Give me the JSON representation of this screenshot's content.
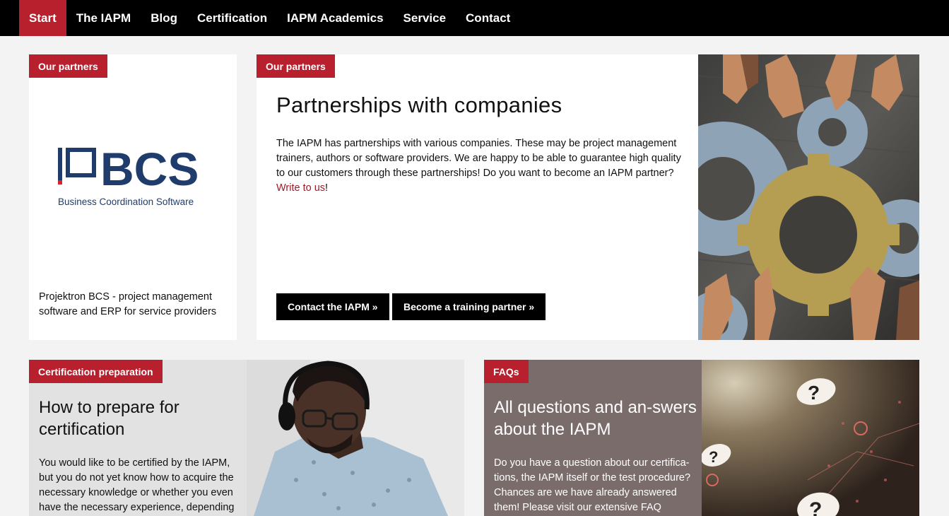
{
  "nav": {
    "items": [
      {
        "label": "Start",
        "active": true
      },
      {
        "label": "The IAPM"
      },
      {
        "label": "Blog"
      },
      {
        "label": "Certification"
      },
      {
        "label": "IAPM Academics"
      },
      {
        "label": "Service"
      },
      {
        "label": "Contact"
      }
    ]
  },
  "partner_logo_card": {
    "tag": "Our partners",
    "logo_text": "BCS",
    "logo_subtext": "Business Coordination Software",
    "description": "Projektron BCS - project management software and ERP for service providers"
  },
  "partnerships_card": {
    "tag": "Our partners",
    "title": "Partnerships with companies",
    "body": "The IAPM has partnerships with various companies. These may be project management trainers, authors or software providers. We are happy to be able to guarantee high quality to our customers through these partnerships! Do you want to become an IAPM partner?",
    "link_text": "Write to us",
    "link_suffix": "!",
    "button_contact": "Contact the IAPM »",
    "button_training": "Become a training partner »"
  },
  "cert_card": {
    "tag": "Certification preparation",
    "title": "How to prepare for certification",
    "body": "You would like to be certified by the IAPM, but you do not yet know how to acquire the necessary knowledge or whether you even have the necessary experience, depending"
  },
  "faq_card": {
    "tag": "FAQs",
    "title": "All questions and an-swers about the IAPM",
    "body": "Do you have a question about our certifica-tions, the IAPM itself or the test procedure? Chances are we have already answered them! Please visit our extensive FAQ"
  },
  "colors": {
    "accent": "#b8202e",
    "nav_bg": "#000000",
    "faq_bg": "#7a6c6b"
  }
}
